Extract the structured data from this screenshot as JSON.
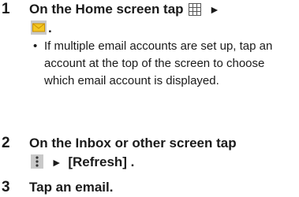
{
  "steps": [
    {
      "num": "1",
      "text_a": "On the Home screen tap",
      "arrow": "►",
      "text_b": ".",
      "icons": [
        "apps-grid-icon",
        "email-envelope-icon"
      ],
      "bullet": "If multiple email accounts are set up, tap an account at the top of the screen to choose which email account is displayed."
    },
    {
      "num": "2",
      "line1": "On the Inbox or other screen tap",
      "arrow": "►",
      "menu_item": "[Refresh] .",
      "icons": [
        "menu-kebab-icon"
      ]
    },
    {
      "num": "3",
      "line1": "Tap an email."
    }
  ],
  "colors": {
    "text": "#1a1a1a",
    "icon_gray": "#b5b5b5",
    "envelope_yellow": "#f3c623"
  }
}
